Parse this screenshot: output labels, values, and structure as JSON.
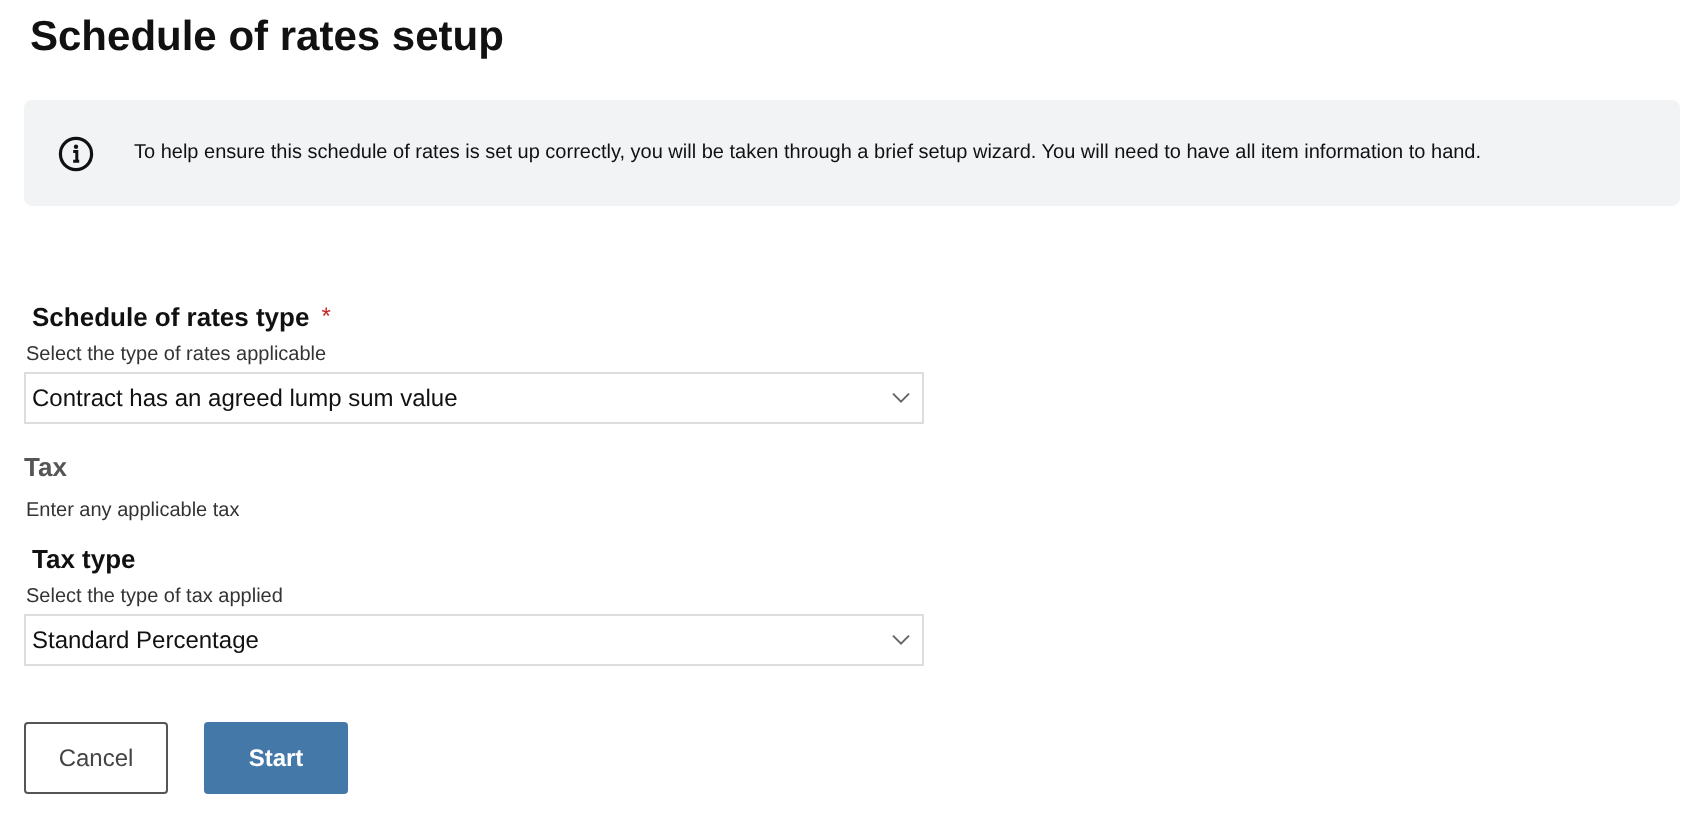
{
  "title": "Schedule of rates setup",
  "info": {
    "text": "To help ensure this schedule of rates is set up correctly, you will be taken through a brief setup wizard. You will need to have all item information to hand."
  },
  "form": [
    {
      "kind": "select",
      "label": "Schedule of rates type",
      "required_mark": "*",
      "hint": "Select the type of rates applicable",
      "value": "Contract has an agreed lump sum value"
    },
    {
      "kind": "section",
      "label": "Tax",
      "hint": "Enter any applicable tax"
    },
    {
      "kind": "select",
      "label": "Tax type",
      "hint": "Select the type of tax applied",
      "value": "Standard Percentage"
    }
  ],
  "buttons": [
    {
      "kind": "secondary",
      "label": "Cancel"
    },
    {
      "kind": "primary",
      "label": "Start"
    }
  ]
}
